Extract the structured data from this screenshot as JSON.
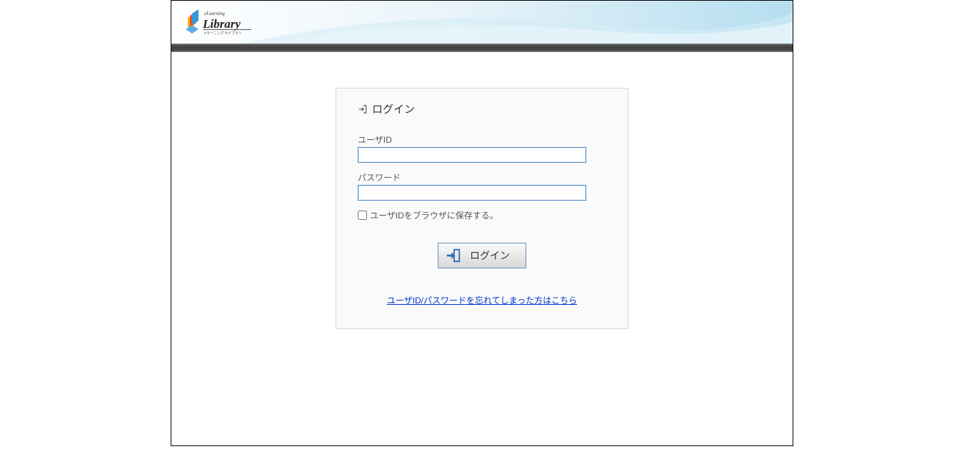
{
  "brand": {
    "prefix": "eLearning",
    "name": "Library",
    "tagline": "eラーニングライブラリ"
  },
  "login": {
    "title": "ログイン",
    "user_id_label": "ユーザID",
    "user_id_value": "",
    "password_label": "パスワード",
    "password_value": "",
    "remember_label": "ユーザIDをブラウザに保存する。",
    "button_label": "ログイン",
    "forgot_link": "ユーザID/パスワードを忘れてしまった方はこちら"
  }
}
